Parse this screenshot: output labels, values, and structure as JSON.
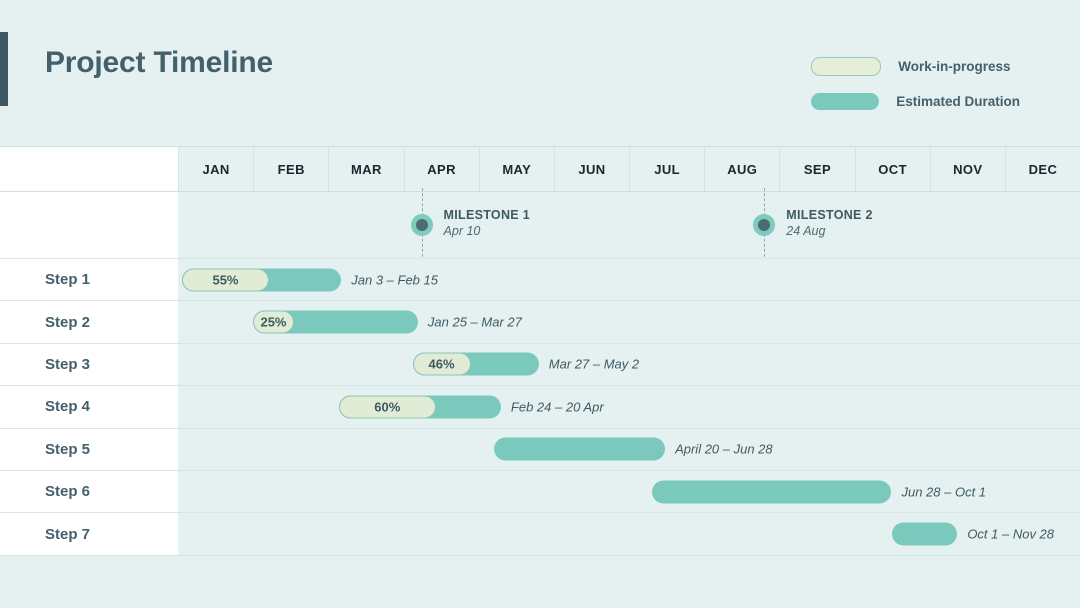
{
  "header": {
    "title": "Project Timeline"
  },
  "legend": {
    "items": [
      {
        "label": "Work-in-progress",
        "swatch": "wip",
        "color": "#e4eed8"
      },
      {
        "label": "Estimated Duration",
        "swatch": "dur",
        "color": "#7ac9bc"
      }
    ]
  },
  "chart_data": {
    "type": "bar",
    "title": "Project Timeline",
    "xlabel": "",
    "ylabel": "",
    "categories": [
      "JAN",
      "FEB",
      "MAR",
      "APR",
      "MAY",
      "JUN",
      "JUL",
      "AUG",
      "SEP",
      "OCT",
      "NOV",
      "DEC"
    ],
    "grid": true,
    "legend_position": "top-right",
    "colors": {
      "duration_bar": "#7ac9bc",
      "progress_fill": "#e0ecd5",
      "progress_border": "#8dc6b4",
      "accent": "#3d5a64",
      "background": "#e5f0f0",
      "label_column": "#ffffff",
      "text": "#44606b"
    },
    "milestones": [
      {
        "name": "MILESTONE 1",
        "date": "Apr 10",
        "left_pct": 27.0
      },
      {
        "name": "MILESTONE 2",
        "date": "24 Aug",
        "left_pct": 65.0
      }
    ],
    "tasks": [
      {
        "label": "Step 1",
        "range": "Jan 3 – Feb 15",
        "progress": "55%",
        "start_pct": 0.4,
        "width_pct": 17.7,
        "progress_pct": 55
      },
      {
        "label": "Step 2",
        "range": "Jan 25 – Mar 27",
        "progress": "25%",
        "start_pct": 8.3,
        "width_pct": 18.3,
        "progress_pct": 25
      },
      {
        "label": "Step 3",
        "range": "Mar 27 – May 2",
        "progress": "46%",
        "start_pct": 26.0,
        "width_pct": 14.0,
        "progress_pct": 46
      },
      {
        "label": "Step 4",
        "range": "Feb 24 – 20 Apr",
        "progress": "60%",
        "start_pct": 17.8,
        "width_pct": 18.0,
        "progress_pct": 60
      },
      {
        "label": "Step 5",
        "range": "April 20 – Jun 28",
        "progress": null,
        "start_pct": 35.0,
        "width_pct": 19.0,
        "progress_pct": 0
      },
      {
        "label": "Step 6",
        "range": "Jun 28 – Oct 1",
        "progress": null,
        "start_pct": 52.6,
        "width_pct": 26.5,
        "progress_pct": 0
      },
      {
        "label": "Step 7",
        "range": "Oct 1 – Nov 28",
        "progress": null,
        "start_pct": 79.2,
        "width_pct": 7.2,
        "progress_pct": 0
      }
    ]
  }
}
